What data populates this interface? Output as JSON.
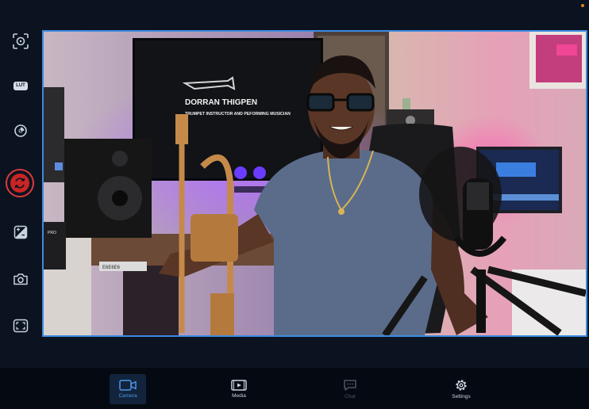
{
  "toolbar": {
    "items": [
      {
        "name": "focus-target-icon"
      },
      {
        "name": "lut-icon",
        "badge": "LUT"
      },
      {
        "name": "exposure-dial-icon"
      },
      {
        "name": "record-rotate-icon"
      },
      {
        "name": "color-balance-icon"
      },
      {
        "name": "snapshot-camera-icon"
      },
      {
        "name": "fullscreen-frame-icon"
      }
    ]
  },
  "preview": {
    "tv_name": "DORRAN THIGPEN",
    "tv_subtitle": "TRUMPET INSTRUCTOR AND PEFORMING MUSICIAN",
    "speaker_label": "PRO",
    "rack_label": "E6E6E6"
  },
  "bottom_nav": {
    "tabs": [
      {
        "label": "Camera",
        "icon": "camera-icon",
        "state": "active"
      },
      {
        "label": "Media",
        "icon": "media-icon",
        "state": "normal"
      },
      {
        "label": "Chat",
        "icon": "chat-icon",
        "state": "disabled"
      },
      {
        "label": "Settings",
        "icon": "gear-icon",
        "state": "normal"
      }
    ]
  },
  "colors": {
    "background": "#0b1320",
    "accent": "#3d8ae0",
    "record": "#c82525",
    "status_dot": "#e8801f"
  }
}
